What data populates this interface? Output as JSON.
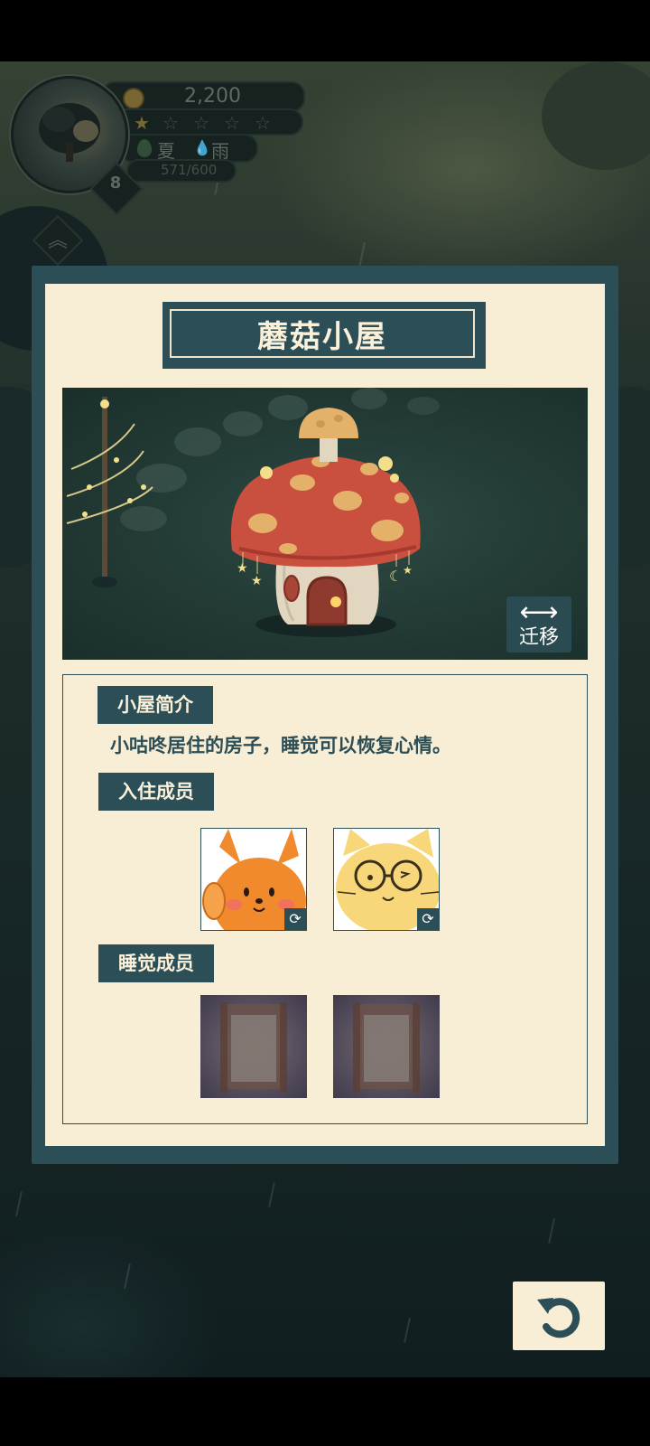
{
  "hud": {
    "coins": "2,200",
    "stars_filled": 1,
    "stars_total": 5,
    "season": "夏",
    "weather": "雨",
    "xp": "571/600",
    "level": "8"
  },
  "dialog": {
    "title": "蘑菇小屋",
    "move_label": "迁移",
    "intro_header": "小屋简介",
    "intro_text": "小咕咚居住的房子，睡觉可以恢复心情。",
    "residents_header": "入住成员",
    "sleepers_header": "睡觉成员"
  },
  "residents": [
    {
      "name": "fox-resident"
    },
    {
      "name": "cat-resident"
    }
  ],
  "sleepers": [
    {
      "state": "empty"
    },
    {
      "state": "empty"
    }
  ],
  "colors": {
    "panel": "#2c4e56",
    "paper": "#f8edd5",
    "mushroom_cap": "#c9503f",
    "spots": "#e4b16a"
  }
}
